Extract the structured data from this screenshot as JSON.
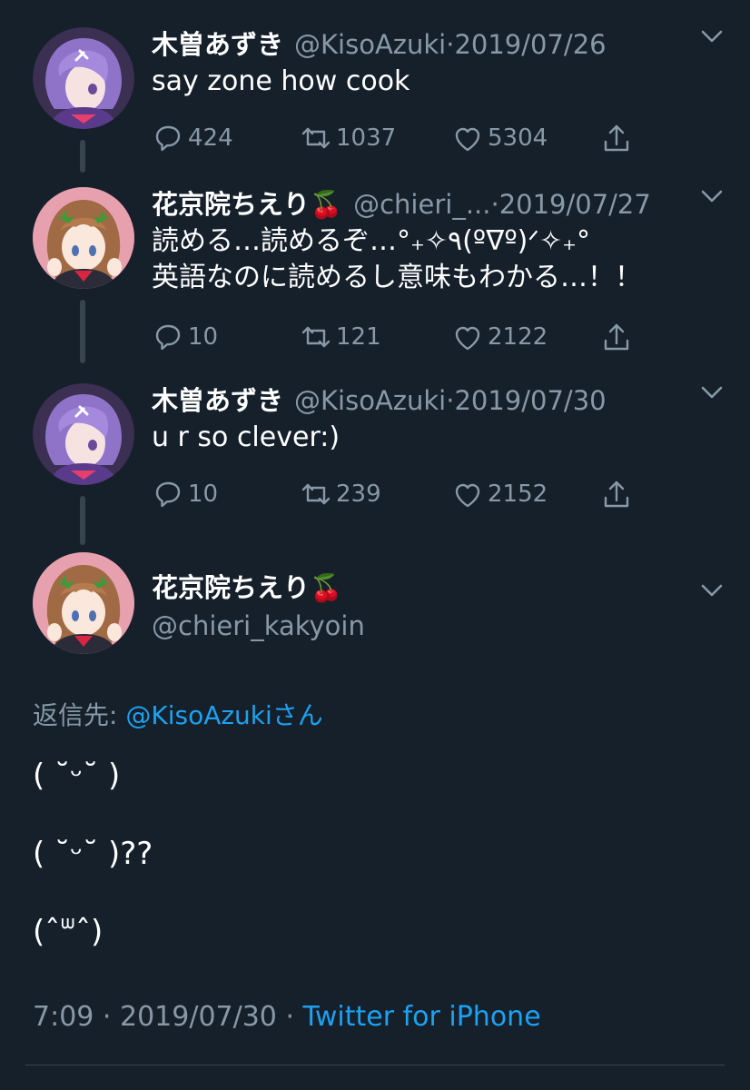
{
  "colors": {
    "background": "#15202b",
    "primary_text": "#ffffff",
    "secondary_text": "#8899a6",
    "accent": "#1da1f2",
    "thread_line": "#38444d"
  },
  "tweets": [
    {
      "name": "木曽あずき",
      "handle": "@KisoAzuki",
      "sep": "·",
      "date": "2019/07/26",
      "text": "say zone how cook",
      "replies": "424",
      "retweets": "1037",
      "likes": "5304",
      "avatar": "purple-hair-avatar"
    },
    {
      "name": "花京院ちえり🍒",
      "handle": "@chieri_...",
      "sep": "·",
      "date": "2019/07/27",
      "text": "読める…読めるぞ…°₊✧٩(ºᐁº)ᐟ✧₊°\n英語なのに読めるし意味もわかる…！！",
      "replies": "10",
      "retweets": "121",
      "likes": "2122",
      "avatar": "brown-hair-avatar"
    },
    {
      "name": "木曽あずき",
      "handle": "@KisoAzuki",
      "sep": "·",
      "date": "2019/07/30",
      "text": "u r so clever:)",
      "replies": "10",
      "retweets": "239",
      "likes": "2152",
      "avatar": "purple-hair-avatar"
    }
  ],
  "main_tweet": {
    "name": "花京院ちえり🍒",
    "handle": "@chieri_kakyoin",
    "reply_to_label": "返信先: ",
    "reply_to_mention": "@KisoAzuki",
    "reply_to_suffix": "さん",
    "lines": [
      "( ˘ᵕ˘ )",
      "( ˘ᵕ˘ )??",
      "(ˆᐜˆ)"
    ],
    "time": "7:09",
    "sep1": " · ",
    "date": "2019/07/30",
    "sep2": " · ",
    "source": "Twitter for iPhone",
    "avatar": "brown-hair-avatar"
  }
}
